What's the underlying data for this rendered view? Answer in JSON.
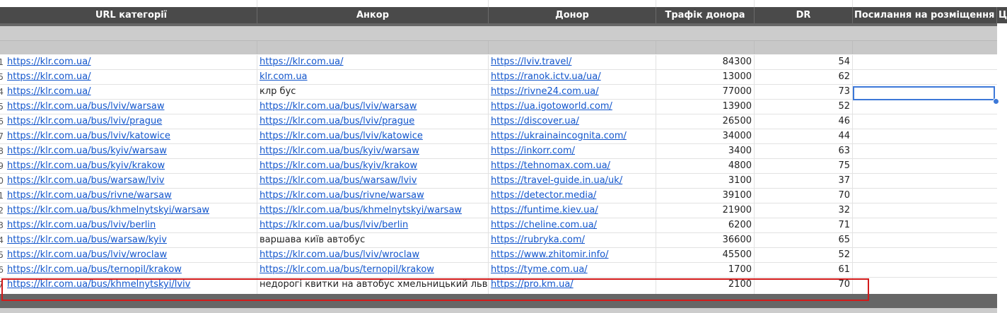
{
  "header": {
    "col_url": "URL категорії",
    "col_anchor": "Анкор",
    "col_donor": "Донор",
    "col_traffic": "Трафік донора",
    "col_dr": "DR",
    "col_placement": "Посилання на розміщення",
    "col_next": "Ц"
  },
  "rows": [
    {
      "rn": "1",
      "url": "https://klr.com.ua/",
      "anchor": "https://klr.com.ua/",
      "anchor_link": true,
      "donor": "https://lviv.travel/",
      "traffic": "84300",
      "dr": "54"
    },
    {
      "rn": "5",
      "url": "https://klr.com.ua/",
      "anchor": "klr.com.ua",
      "anchor_link": true,
      "donor": "https://ranok.ictv.ua/ua/",
      "traffic": "13000",
      "dr": "62"
    },
    {
      "rn": "4",
      "url": "https://klr.com.ua/",
      "anchor": "клр бус",
      "anchor_link": false,
      "donor": "https://rivne24.com.ua/",
      "traffic": "77000",
      "dr": "73"
    },
    {
      "rn": "5",
      "url": "https://klr.com.ua/bus/lviv/warsaw",
      "anchor": "https://klr.com.ua/bus/lviv/warsaw",
      "anchor_link": true,
      "donor": "https://ua.igotoworld.com/",
      "traffic": "13900",
      "dr": "52"
    },
    {
      "rn": "6",
      "url": "https://klr.com.ua/bus/lviv/prague",
      "anchor": "https://klr.com.ua/bus/lviv/prague",
      "anchor_link": true,
      "donor": "https://discover.ua/",
      "traffic": "26500",
      "dr": "46"
    },
    {
      "rn": "7",
      "url": "https://klr.com.ua/bus/lviv/katowice",
      "anchor": "https://klr.com.ua/bus/lviv/katowice",
      "anchor_link": true,
      "donor": "https://ukrainaincognita.com/",
      "traffic": "34000",
      "dr": "44"
    },
    {
      "rn": "8",
      "url": "https://klr.com.ua/bus/kyiv/warsaw",
      "anchor": "https://klr.com.ua/bus/kyiv/warsaw",
      "anchor_link": true,
      "donor": "https://inkorr.com/",
      "traffic": "3400",
      "dr": "63"
    },
    {
      "rn": "9",
      "url": "https://klr.com.ua/bus/kyiv/krakow",
      "anchor": "https://klr.com.ua/bus/kyiv/krakow",
      "anchor_link": true,
      "donor": "https://tehnomax.com.ua/",
      "traffic": "4800",
      "dr": "75"
    },
    {
      "rn": "0",
      "url": "https://klr.com.ua/bus/warsaw/lviv",
      "anchor": "https://klr.com.ua/bus/warsaw/lviv",
      "anchor_link": true,
      "donor": "https://travel-guide.in.ua/uk/",
      "traffic": "3100",
      "dr": "37"
    },
    {
      "rn": "1",
      "url": "https://klr.com.ua/bus/rivne/warsaw",
      "anchor": "https://klr.com.ua/bus/rivne/warsaw",
      "anchor_link": true,
      "donor": "https://detector.media/",
      "traffic": "39100",
      "dr": "70"
    },
    {
      "rn": "2",
      "url": "https://klr.com.ua/bus/khmelnytskyi/warsaw",
      "anchor": "https://klr.com.ua/bus/khmelnytskyi/warsaw",
      "anchor_link": true,
      "donor": "https://funtime.kiev.ua/",
      "traffic": "21900",
      "dr": "32"
    },
    {
      "rn": "3",
      "url": "https://klr.com.ua/bus/lviv/berlin",
      "anchor": "https://klr.com.ua/bus/lviv/berlin",
      "anchor_link": true,
      "donor": "https://cheline.com.ua/",
      "traffic": "6200",
      "dr": "71"
    },
    {
      "rn": "4",
      "url": "https://klr.com.ua/bus/warsaw/kyiv",
      "anchor": "варшава київ автобус",
      "anchor_link": false,
      "donor": "https://rubryka.com/",
      "traffic": "36600",
      "dr": "65"
    },
    {
      "rn": "5",
      "url": "https://klr.com.ua/bus/lviv/wroclaw",
      "anchor": "https://klr.com.ua/bus/lviv/wroclaw",
      "anchor_link": true,
      "donor": "https://www.zhitomir.info/",
      "traffic": "45500",
      "dr": "52"
    },
    {
      "rn": "6",
      "url": "https://klr.com.ua/bus/ternopil/krakow",
      "anchor": "https://klr.com.ua/bus/ternopil/krakow",
      "anchor_link": true,
      "donor": "https://tyme.com.ua/",
      "traffic": "1700",
      "dr": "61"
    },
    {
      "rn": "7",
      "url": "https://klr.com.ua/bus/khmelnytskyi/lviv",
      "anchor": "недорогі квитки на автобус хмельницький львів",
      "anchor_link": false,
      "donor": "https://pro.km.ua/",
      "traffic": "2100",
      "dr": "70"
    }
  ],
  "colors": {
    "header_bg": "#4a4a4a",
    "link": "#1155cc",
    "highlight_box": "#d21a1a",
    "selection": "#3c78d8"
  }
}
